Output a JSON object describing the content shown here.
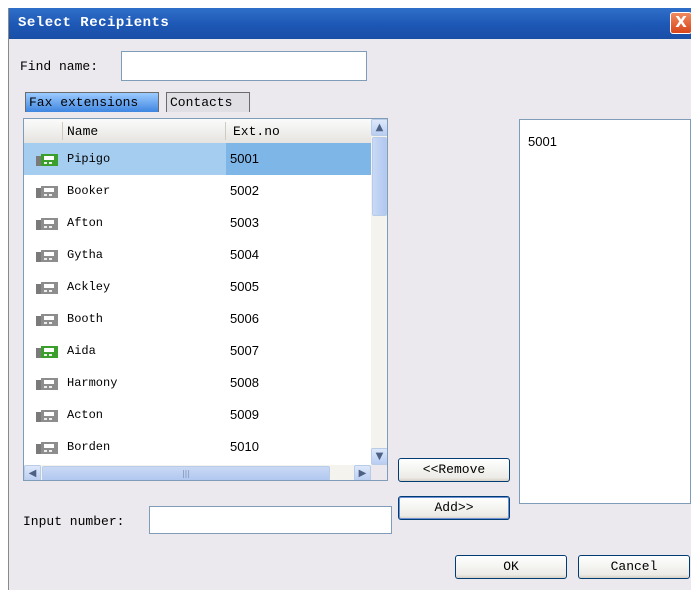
{
  "dialog": {
    "title": "Select Recipients",
    "close_label": "X"
  },
  "find": {
    "label": "Find name:",
    "value": ""
  },
  "tabs": [
    {
      "label": "Fax extensions",
      "active": true
    },
    {
      "label": "Contacts",
      "active": false
    }
  ],
  "list": {
    "columns": {
      "name": "Name",
      "ext": "Ext.no"
    },
    "rows": [
      {
        "name": "Pipigo",
        "ext": "5001",
        "icon": "fax-icon-green",
        "selected": true
      },
      {
        "name": "Booker",
        "ext": "5002",
        "icon": "fax-icon-gray",
        "selected": false
      },
      {
        "name": "Afton",
        "ext": "5003",
        "icon": "fax-icon-gray",
        "selected": false
      },
      {
        "name": "Gytha",
        "ext": "5004",
        "icon": "fax-icon-gray",
        "selected": false
      },
      {
        "name": "Ackley",
        "ext": "5005",
        "icon": "fax-icon-gray",
        "selected": false
      },
      {
        "name": "Booth",
        "ext": "5006",
        "icon": "fax-icon-gray",
        "selected": false
      },
      {
        "name": "Aida",
        "ext": "5007",
        "icon": "fax-icon-green",
        "selected": false
      },
      {
        "name": "Harmony",
        "ext": "5008",
        "icon": "fax-icon-gray",
        "selected": false
      },
      {
        "name": "Acton",
        "ext": "5009",
        "icon": "fax-icon-gray",
        "selected": false
      },
      {
        "name": "Borden",
        "ext": "5010",
        "icon": "fax-icon-gray",
        "selected": false
      }
    ]
  },
  "buttons": {
    "remove": "<<Remove",
    "add": "Add>>",
    "ok": "OK",
    "cancel": "Cancel"
  },
  "recipients": {
    "items": [
      "5001"
    ]
  },
  "input_number": {
    "label": "Input number:",
    "value": ""
  },
  "colors": {
    "titlebar": "#1d57b5",
    "selection": "#a5cdf0",
    "dialog_bg": "#ebe9ed",
    "online_icon": "#3aa02b"
  }
}
